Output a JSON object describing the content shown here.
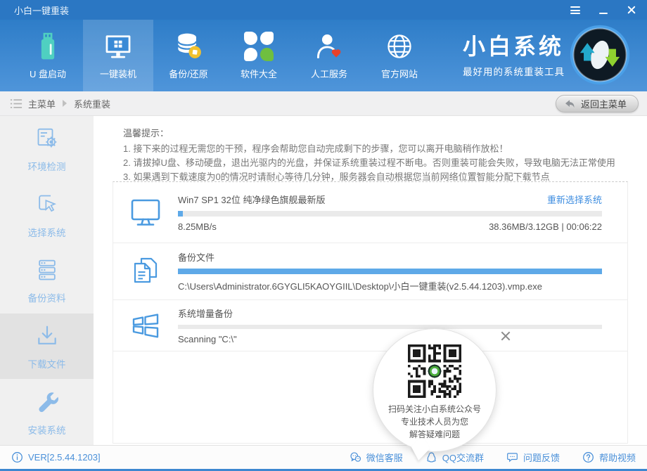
{
  "window": {
    "title": "小白一键重装"
  },
  "nav": {
    "items": [
      {
        "label": "U 盘启动"
      },
      {
        "label": "一键装机"
      },
      {
        "label": "备份/还原"
      },
      {
        "label": "软件大全"
      },
      {
        "label": "人工服务"
      },
      {
        "label": "官方网站"
      }
    ],
    "brand": {
      "name": "小白系统",
      "tagline": "最好用的系统重装工具"
    }
  },
  "breadcrumb": {
    "root": "主菜单",
    "current": "系统重装",
    "back_button": "返回主菜单"
  },
  "sidebar": {
    "items": [
      {
        "label": "环境检测"
      },
      {
        "label": "选择系统"
      },
      {
        "label": "备份资料"
      },
      {
        "label": "下载文件"
      },
      {
        "label": "安装系统"
      }
    ]
  },
  "tips": {
    "title": "温馨提示：",
    "lines": [
      "1. 接下来的过程无需您的干预，程序会帮助您自动完成剩下的步骤，您可以离开电脑稍作放松！",
      "2. 请拔掉U盘、移动硬盘，退出光驱内的光盘，并保证系统重装过程不断电。否则重装可能会失败，导致电脑无法正常使用",
      "3. 如果遇到下载速度为0的情况时请耐心等待几分钟，服务器会自动根据您当前网络位置智能分配下载节点"
    ]
  },
  "download": {
    "title": "Win7 SP1 32位 纯净绿色旗舰最新版",
    "reselect_link": "重新选择系统",
    "speed": "8.25MB/s",
    "stats": "38.36MB/3.12GB | 00:06:22",
    "progress_percent": 1.2
  },
  "backup": {
    "title": "备份文件",
    "path": "C:\\Users\\Administrator.6GYGLI5KAOYGIIL\\Desktop\\小白一键重装(v2.5.44.1203).vmp.exe",
    "progress_percent": 100
  },
  "system_backup": {
    "title": "系统增量备份",
    "status": "Scanning \"C:\\\"",
    "progress_percent": 0
  },
  "qr_popup": {
    "lines": [
      "扫码关注小白系统公众号",
      "专业技术人员为您",
      "解答疑难问题"
    ]
  },
  "footer": {
    "version": "VER[2.5.44.1203]",
    "links": [
      "微信客服",
      "QQ交流群",
      "问题反馈",
      "帮助视频"
    ]
  },
  "colors": {
    "accent_blue": "#4a90d9",
    "progress_fill": "#5ea9e8",
    "header_top": "#2e7dc8",
    "header_bottom": "#4f95da",
    "link": "#3f8ee0",
    "usb_teal": "#4fd0c1",
    "leaf_green": "#6fbf3f",
    "heart_red": "#e8402a"
  }
}
